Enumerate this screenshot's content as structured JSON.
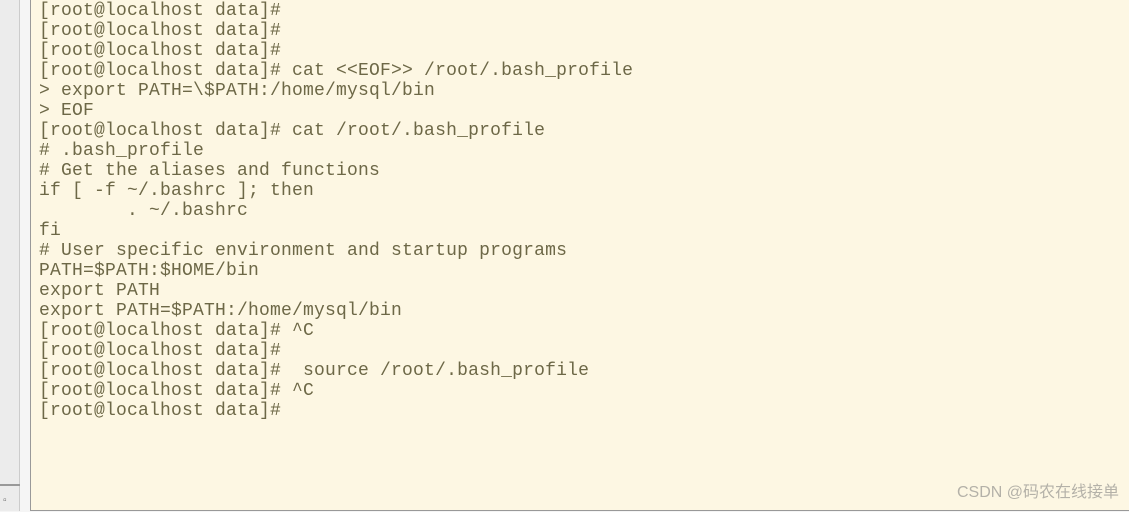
{
  "terminal": {
    "lines": [
      "[root@localhost data]#",
      "[root@localhost data]#",
      "[root@localhost data]#",
      "[root@localhost data]# cat <<EOF>> /root/.bash_profile",
      "> export PATH=\\$PATH:/home/mysql/bin",
      "> EOF",
      "[root@localhost data]# cat /root/.bash_profile",
      "# .bash_profile",
      "",
      "# Get the aliases and functions",
      "if [ -f ~/.bashrc ]; then",
      "        . ~/.bashrc",
      "fi",
      "",
      "# User specific environment and startup programs",
      "",
      "PATH=$PATH:$HOME/bin",
      "",
      "export PATH",
      "export PATH=$PATH:/home/mysql/bin",
      "[root@localhost data]# ^C",
      "[root@localhost data]#",
      "[root@localhost data]#  source /root/.bash_profile",
      "[root@localhost data]# ^C",
      "[root@localhost data]#"
    ]
  },
  "watermark": {
    "text": "CSDN @码农在线接单"
  }
}
